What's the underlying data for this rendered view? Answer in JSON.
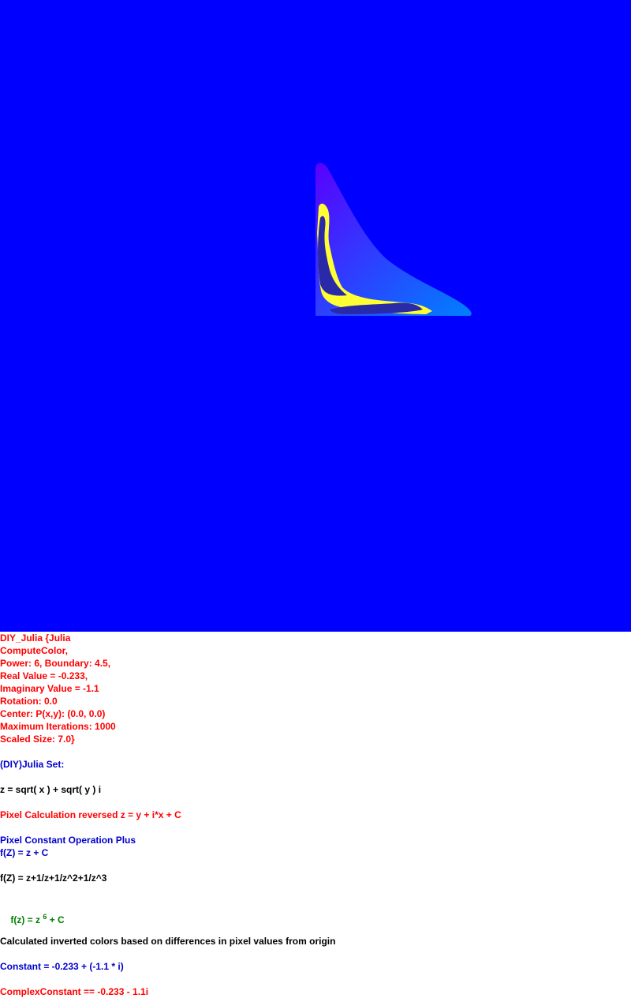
{
  "render": {
    "background_color": "#0000ff",
    "fractal_colors": [
      "#5a00ff",
      "#0080ff",
      "#ffff33",
      "#2a2aa8"
    ],
    "image_description_name": "julia-set-render"
  },
  "params": {
    "lines": [
      "DIY_Julia {Julia",
      "ComputeColor,",
      "Power: 6, Boundary: 4.5,",
      "Real Value = -0.233,",
      "Imaginary Value = -1.1",
      "Rotation: 0.0",
      "Center: P(x,y): (0.0, 0.0)",
      "Maximum Iterations: 1000",
      "Scaled Size: 7.0}"
    ]
  },
  "formulas": {
    "set_title": "(DIY)Julia Set:",
    "z_def": "z = sqrt( x ) + sqrt( y ) i",
    "pixel_calc": "Pixel Calculation reversed z = y + i*x + C",
    "pixel_op": "Pixel Constant Operation Plus",
    "f_plus": "f(Z) = z + C",
    "f_series": "f(Z) = z+1/z+1/z^2+1/z^3",
    "f_power_prefix": "f(z) = z ",
    "f_power_exp": "6",
    "f_power_suffix": " + C",
    "colors_note": "Calculated inverted colors based on differences in pixel values from origin",
    "constant": "Constant = -0.233 + (-1.1 * i)",
    "complex_constant": "ComplexConstant == -0.233 - 1.1i"
  }
}
